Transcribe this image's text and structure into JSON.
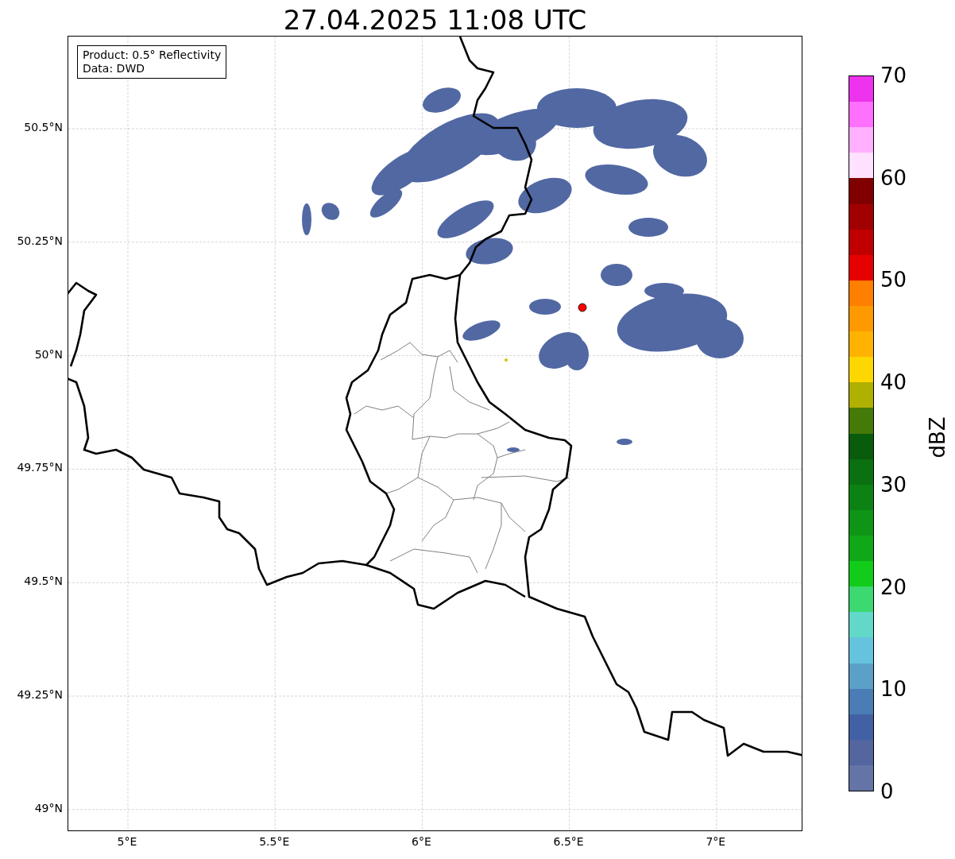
{
  "title": "27.04.2025 11:08 UTC",
  "map": {
    "info_box": [
      "Product: 0.5° Reflectivity",
      "Data: DWD"
    ],
    "lat_labels": [
      "50.5°N",
      "50.25°N",
      "50°N",
      "49.75°N",
      "49.5°N",
      "49.25°N",
      "49°N"
    ],
    "lon_labels": [
      "5°E",
      "5.5°E",
      "6°E",
      "6.5°E",
      "7°E"
    ]
  },
  "colorbar": {
    "label": "dBZ",
    "ticks": [
      "70",
      "60",
      "50",
      "40",
      "30",
      "20",
      "10",
      "0"
    ],
    "segments": [
      {
        "color": "#ee33ee"
      },
      {
        "color": "#ff70ff"
      },
      {
        "color": "#ffb0ff"
      },
      {
        "color": "#ffe0ff"
      },
      {
        "color": "#800000"
      },
      {
        "color": "#a00000"
      },
      {
        "color": "#c00000"
      },
      {
        "color": "#e60000"
      },
      {
        "color": "#ff7f00"
      },
      {
        "color": "#ff9900"
      },
      {
        "color": "#ffb300"
      },
      {
        "color": "#ffd700"
      },
      {
        "color": "#b0b000"
      },
      {
        "color": "#467a08"
      },
      {
        "color": "#085c0c"
      },
      {
        "color": "#0a7010"
      },
      {
        "color": "#0c8214"
      },
      {
        "color": "#0e9516"
      },
      {
        "color": "#10a818"
      },
      {
        "color": "#12cc1a"
      },
      {
        "color": "#3cd870"
      },
      {
        "color": "#62d8c8"
      },
      {
        "color": "#66c3dd"
      },
      {
        "color": "#5aa0c8"
      },
      {
        "color": "#4a7db5"
      },
      {
        "color": "#4260a4"
      },
      {
        "color": "#5366a0"
      },
      {
        "color": "#6574a6"
      }
    ]
  }
}
